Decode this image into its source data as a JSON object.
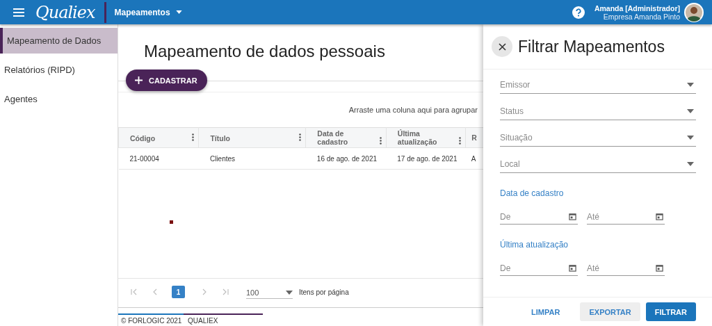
{
  "header": {
    "logo": "Qualiex",
    "module": "Mapeamentos",
    "user_name": "Amanda [Administrador]",
    "company": "Empresa Amanda Pinto"
  },
  "sidebar": {
    "items": [
      {
        "label": "Mapeamento de Dados",
        "selected": true
      },
      {
        "label": "Relatórios (RIPD)",
        "selected": false
      },
      {
        "label": "Agentes",
        "selected": false
      }
    ]
  },
  "main": {
    "title": "Mapeamento de dados pessoais",
    "add_button": "CADASTRAR",
    "group_hint": "Arraste uma coluna aqui para agrupar",
    "table": {
      "columns": [
        "Código",
        "Título",
        "Data de cadastro",
        "Última atualização",
        "R"
      ],
      "rows": [
        [
          "21-00004",
          "Clientes",
          "16 de ago. de 2021",
          "17 de ago. de 2021",
          "A"
        ]
      ]
    },
    "pager": {
      "pages": [
        {
          "label": "1",
          "selected": true
        }
      ],
      "page_size": "100",
      "page_size_label": "Itens por página"
    }
  },
  "footer": {
    "tabs": [
      {
        "label": "© FORLOGIC 2021",
        "color": "#1b75bb"
      },
      {
        "label": "QUALIEX",
        "color": "#4a2358"
      }
    ]
  },
  "filter_panel": {
    "title": "Filtrar Mapeamentos",
    "selects": [
      {
        "placeholder": "Emissor"
      },
      {
        "placeholder": "Status"
      },
      {
        "placeholder": "Situação"
      },
      {
        "placeholder": "Local"
      }
    ],
    "date_groups": [
      {
        "label": "Data de cadastro",
        "from_placeholder": "De",
        "to_placeholder": "Até"
      },
      {
        "label": "Última atualização",
        "from_placeholder": "De",
        "to_placeholder": "Até"
      }
    ],
    "buttons": [
      {
        "label": "LIMPAR",
        "kind": "text"
      },
      {
        "label": "EXPORTAR",
        "kind": "secondary"
      },
      {
        "label": "FILTRAR",
        "kind": "primary"
      }
    ]
  }
}
